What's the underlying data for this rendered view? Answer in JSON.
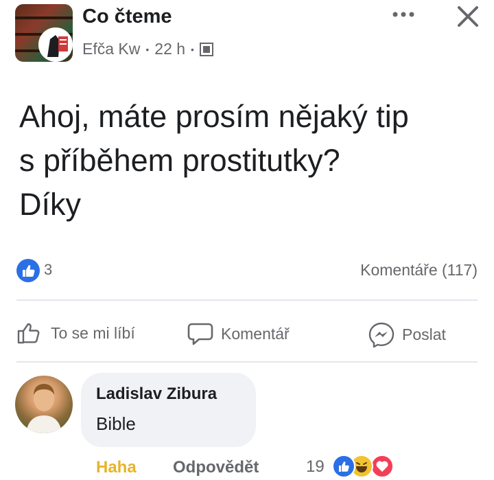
{
  "post": {
    "group_name": "Co čteme",
    "author": "Efča Kw",
    "time": "22 h",
    "separator": "•",
    "text": "Ahoj, máte prosím nějaký tip\ns příběhem prostitutky?\nDíky",
    "like_count": "3",
    "comments_label": "Komentáře (117)"
  },
  "actions": {
    "like": "To se mi líbí",
    "comment": "Komentář",
    "share": "Poslat"
  },
  "comment": {
    "author": "Ladislav Zibura",
    "text": "Bible",
    "reaction_label": "Haha",
    "reply_label": "Odpovědět",
    "reaction_count": "19"
  },
  "colors": {
    "like_blue": "#2b6fe6",
    "haha_yellow": "#e7b32a",
    "love_red": "#f33e58",
    "secondary_text": "#65676b"
  },
  "icons": {
    "more": "more-horizontal-icon",
    "close": "close-icon",
    "audience": "group-audience-icon",
    "like": "thumbs-up-icon",
    "comment": "speech-bubble-icon",
    "share": "messenger-icon"
  }
}
